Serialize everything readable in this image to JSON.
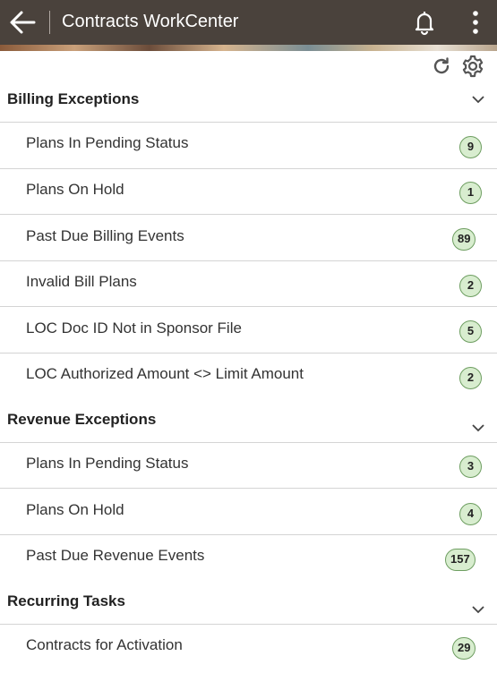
{
  "header": {
    "title": "Contracts WorkCenter",
    "back_icon": "arrow-left-icon",
    "bell_icon": "bell-icon",
    "menu_icon": "kebab-menu-icon"
  },
  "toolbar": {
    "refresh_icon": "refresh-icon",
    "settings_icon": "gear-icon"
  },
  "sections": [
    {
      "title": "Billing Exceptions",
      "items": [
        {
          "label": "Plans In Pending Status",
          "count": "9"
        },
        {
          "label": "Plans On Hold",
          "count": "1"
        },
        {
          "label": "Past Due Billing Events",
          "count": "89"
        },
        {
          "label": "Invalid Bill Plans",
          "count": "2"
        },
        {
          "label": "LOC Doc ID Not in Sponsor File",
          "count": "5"
        },
        {
          "label": "LOC Authorized Amount <> Limit Amount",
          "count": "2"
        }
      ]
    },
    {
      "title": "Revenue Exceptions",
      "items": [
        {
          "label": "Plans In Pending Status",
          "count": "3"
        },
        {
          "label": "Plans On Hold",
          "count": "4"
        },
        {
          "label": "Past Due Revenue Events",
          "count": "157"
        }
      ]
    },
    {
      "title": "Recurring Tasks",
      "items": [
        {
          "label": "Contracts for Activation",
          "count": "29"
        }
      ]
    }
  ],
  "colors": {
    "header_bg": "#4a423c",
    "badge_bg": "#d8edcf",
    "badge_border": "#6e9e61"
  }
}
